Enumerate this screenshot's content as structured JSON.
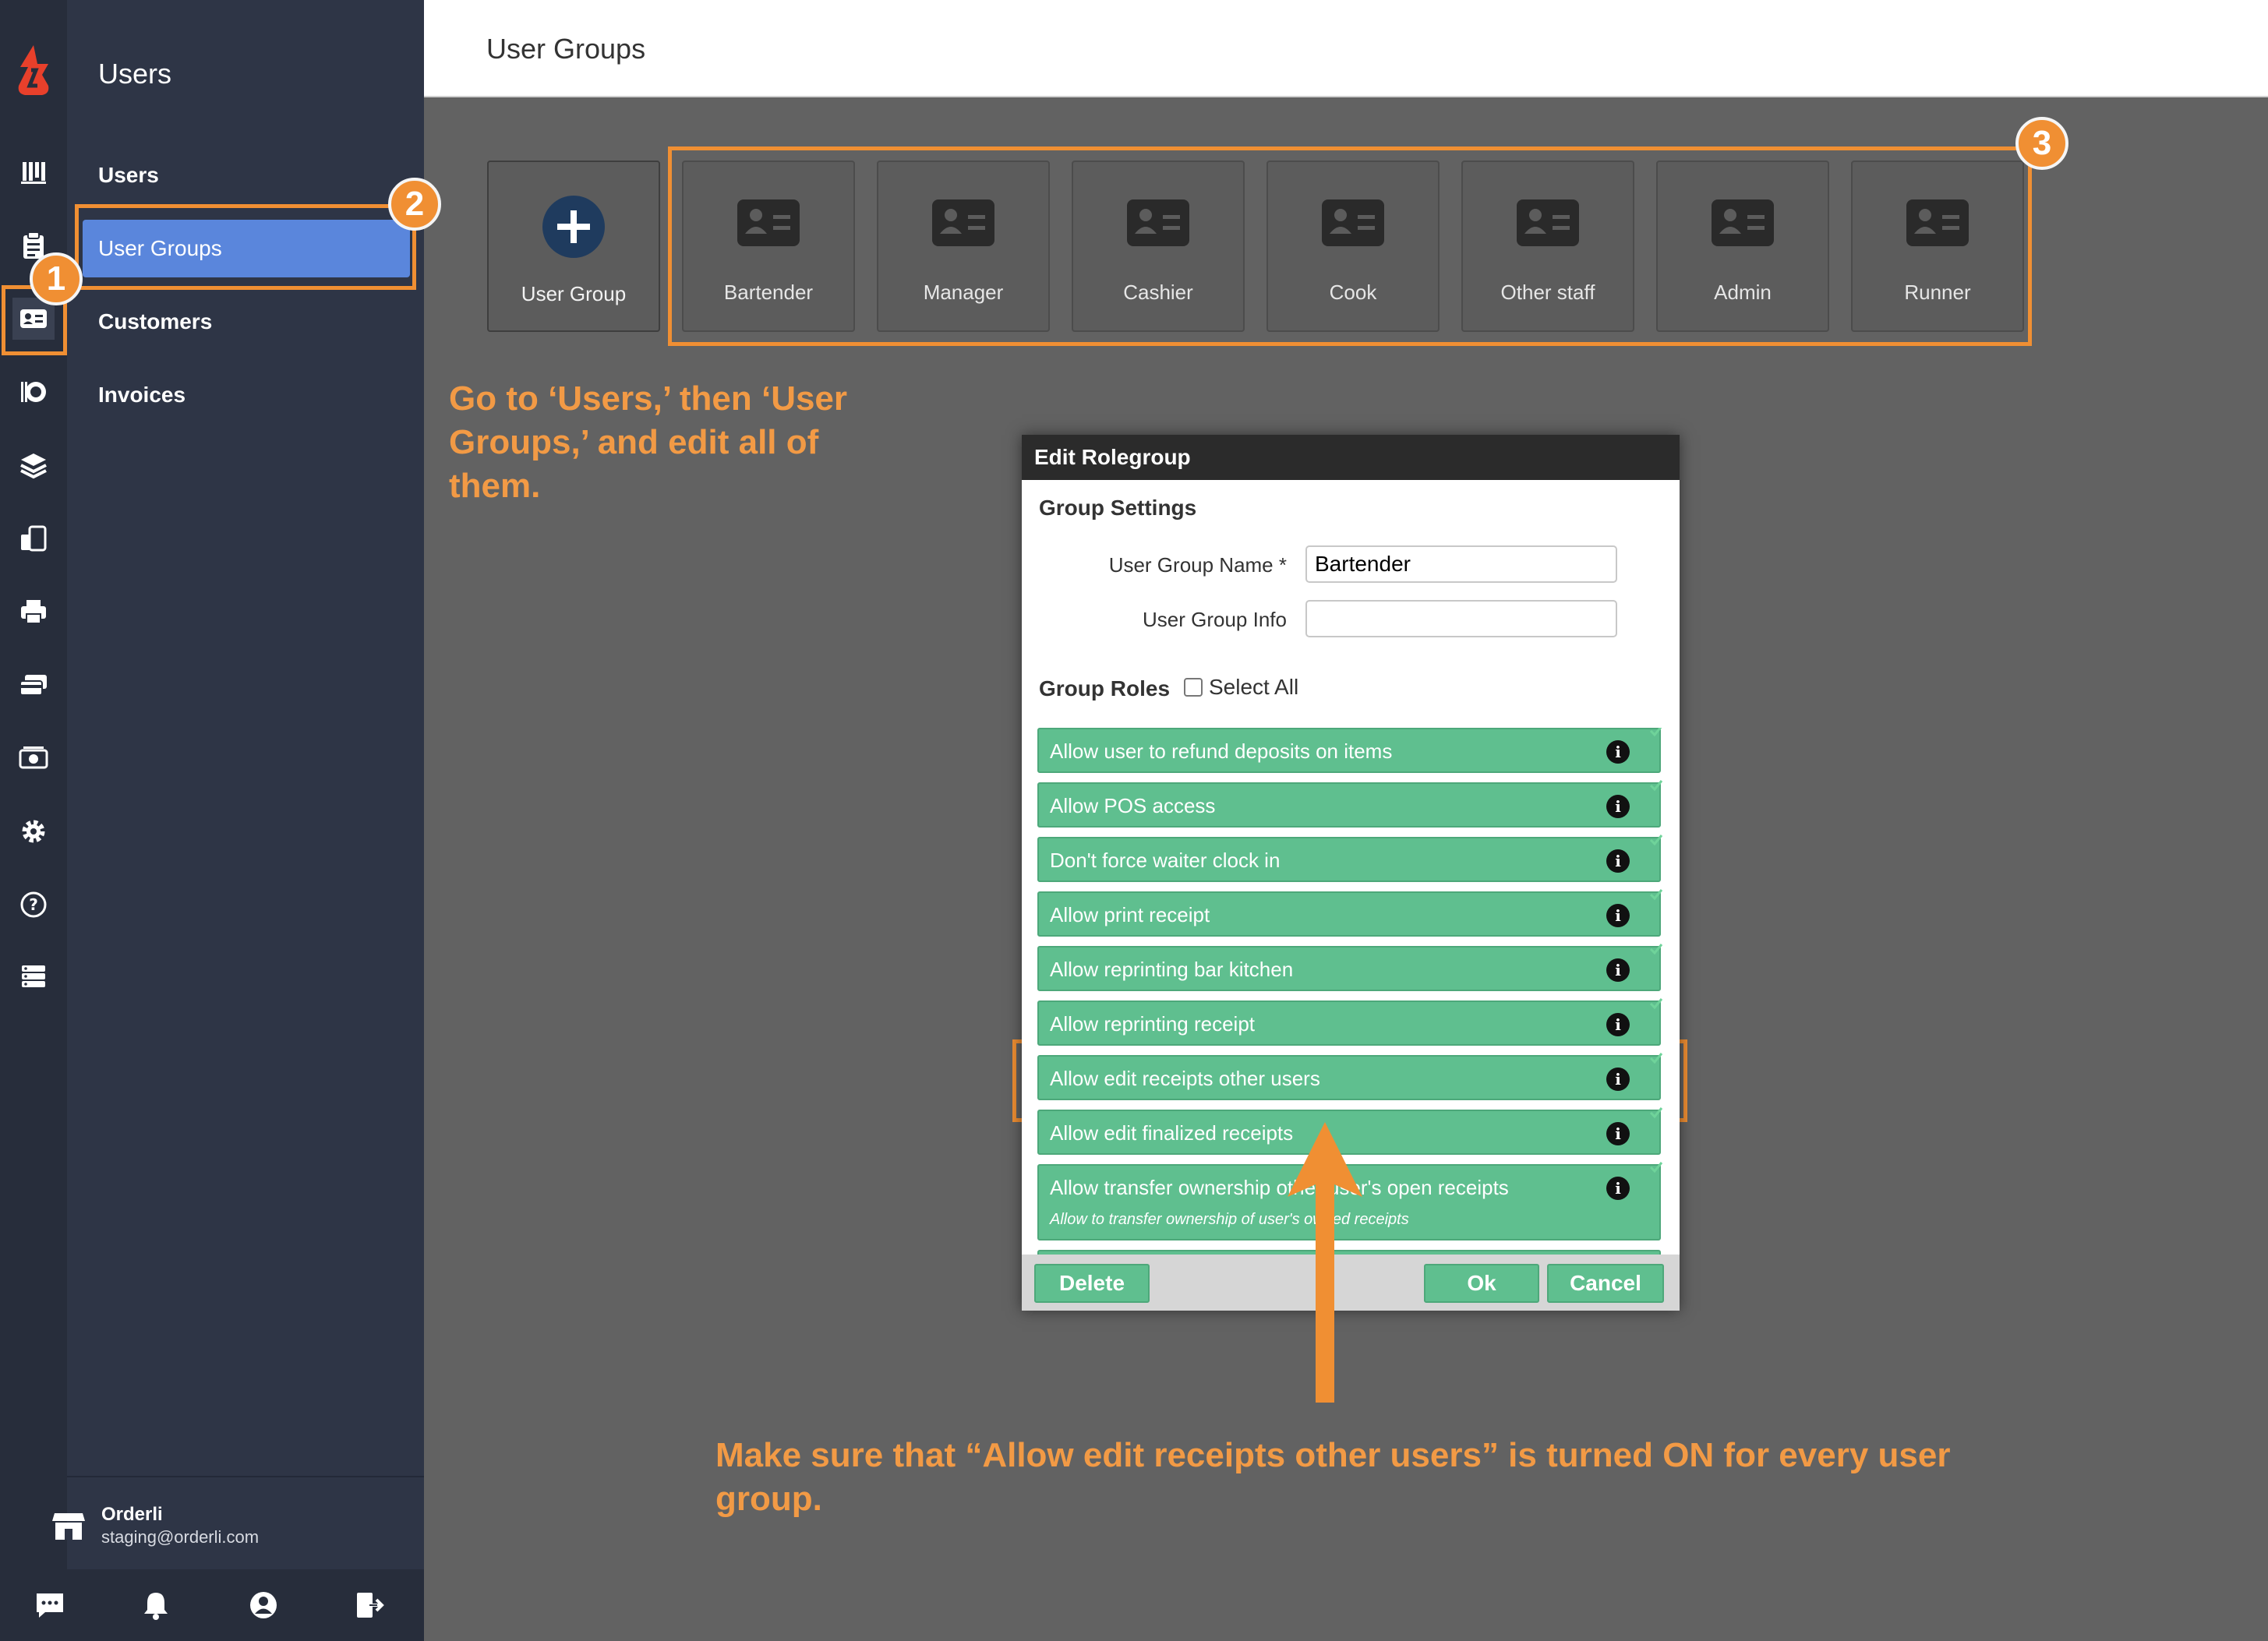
{
  "app": {
    "section_title": "Users",
    "page_title": "User Groups"
  },
  "subnav": {
    "items": [
      {
        "label": "Users"
      },
      {
        "label": "User Groups"
      },
      {
        "label": "Customers"
      },
      {
        "label": "Invoices"
      }
    ],
    "account": {
      "name": "Orderli",
      "email": "staging@orderli.com"
    }
  },
  "rail_icons": [
    "logo-icon",
    "chart-icon",
    "clipboard-icon",
    "user-card-icon",
    "dining-icon",
    "layers-icon",
    "devices-icon",
    "printer-icon",
    "cards-icon",
    "cash-icon",
    "gear-icon",
    "help-icon",
    "server-icon"
  ],
  "bottom_icons": [
    "chat-icon",
    "bell-icon",
    "profile-icon",
    "logout-icon"
  ],
  "tiles": {
    "add_label": "User Group",
    "groups": [
      "Bartender",
      "Manager",
      "Cashier",
      "Cook",
      "Other staff",
      "Admin",
      "Runner"
    ]
  },
  "badges": [
    "1",
    "2",
    "3"
  ],
  "notes": {
    "top": "Go to ‘Users,’ then ‘User Groups,’ and edit all of them.",
    "bottom": "Make sure that “Allow edit receipts other users” is turned ON for every user group."
  },
  "dialog": {
    "title": "Edit Rolegroup",
    "group_settings": "Group Settings",
    "name_label": "User Group Name *",
    "name_value": "Bartender",
    "info_label": "User Group Info",
    "info_value": "",
    "group_roles": "Group Roles",
    "select_all": "Select All",
    "roles": [
      {
        "label": "Allow user to refund deposits on items",
        "sub": ""
      },
      {
        "label": "Allow POS access",
        "sub": ""
      },
      {
        "label": "Don't force waiter clock in",
        "sub": ""
      },
      {
        "label": "Allow print receipt",
        "sub": ""
      },
      {
        "label": "Allow reprinting bar kitchen",
        "sub": ""
      },
      {
        "label": "Allow reprinting receipt",
        "sub": ""
      },
      {
        "label": "Allow edit receipts other users",
        "sub": ""
      },
      {
        "label": "Allow edit finalized receipts",
        "sub": ""
      },
      {
        "label": "Allow transfer ownership other user's open receipts",
        "sub": "Allow to transfer ownership of user's owned receipts"
      }
    ],
    "info_glyph": "i",
    "buttons": {
      "delete": "Delete",
      "ok": "Ok",
      "cancel": "Cancel"
    }
  },
  "colors": {
    "accent": "#f08f33",
    "role_green": "#5fbf8f",
    "active_nav": "#5a86dc",
    "sidebar": "#2e3546"
  }
}
